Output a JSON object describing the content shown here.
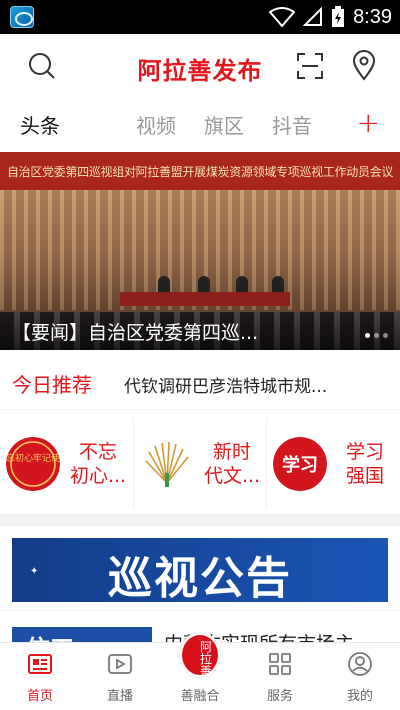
{
  "status_bar": {
    "time": "8:39"
  },
  "header": {
    "title": "阿拉善发布"
  },
  "tabs": [
    {
      "label": "头条"
    },
    {
      "label": "视频"
    },
    {
      "label": "旗区"
    },
    {
      "label": "抖音"
    }
  ],
  "banner": {
    "headline_strip": "自治区党委第四巡视组对阿拉善盟开展煤炭资源领域专项巡视工作动员会议",
    "caption": "【要闻】自治区党委第四巡..."
  },
  "today": {
    "label": "今日推荐",
    "headline": "代钦调研巴彦浩特城市规..."
  },
  "features": [
    {
      "line1": "不忘",
      "line2": "初心...",
      "logo_text": "不忘初心牢记使命"
    },
    {
      "line1": "新时",
      "line2": "代文..."
    },
    {
      "line1": "学习",
      "line2": "强国",
      "logo_text": "学习"
    }
  ],
  "notice": {
    "text": "巡视公告"
  },
  "news": {
    "thumb_text": "信工",
    "title": "内蒙古实现所有市场主"
  },
  "bottom_nav": [
    {
      "label": "首页",
      "active": true
    },
    {
      "label": "直播"
    },
    {
      "label": "善融合",
      "badge_text": "阿拉善"
    },
    {
      "label": "服务"
    },
    {
      "label": "我的"
    }
  ],
  "colors": {
    "accent": "#e3161c",
    "notice_blue": "#1b56b6"
  }
}
